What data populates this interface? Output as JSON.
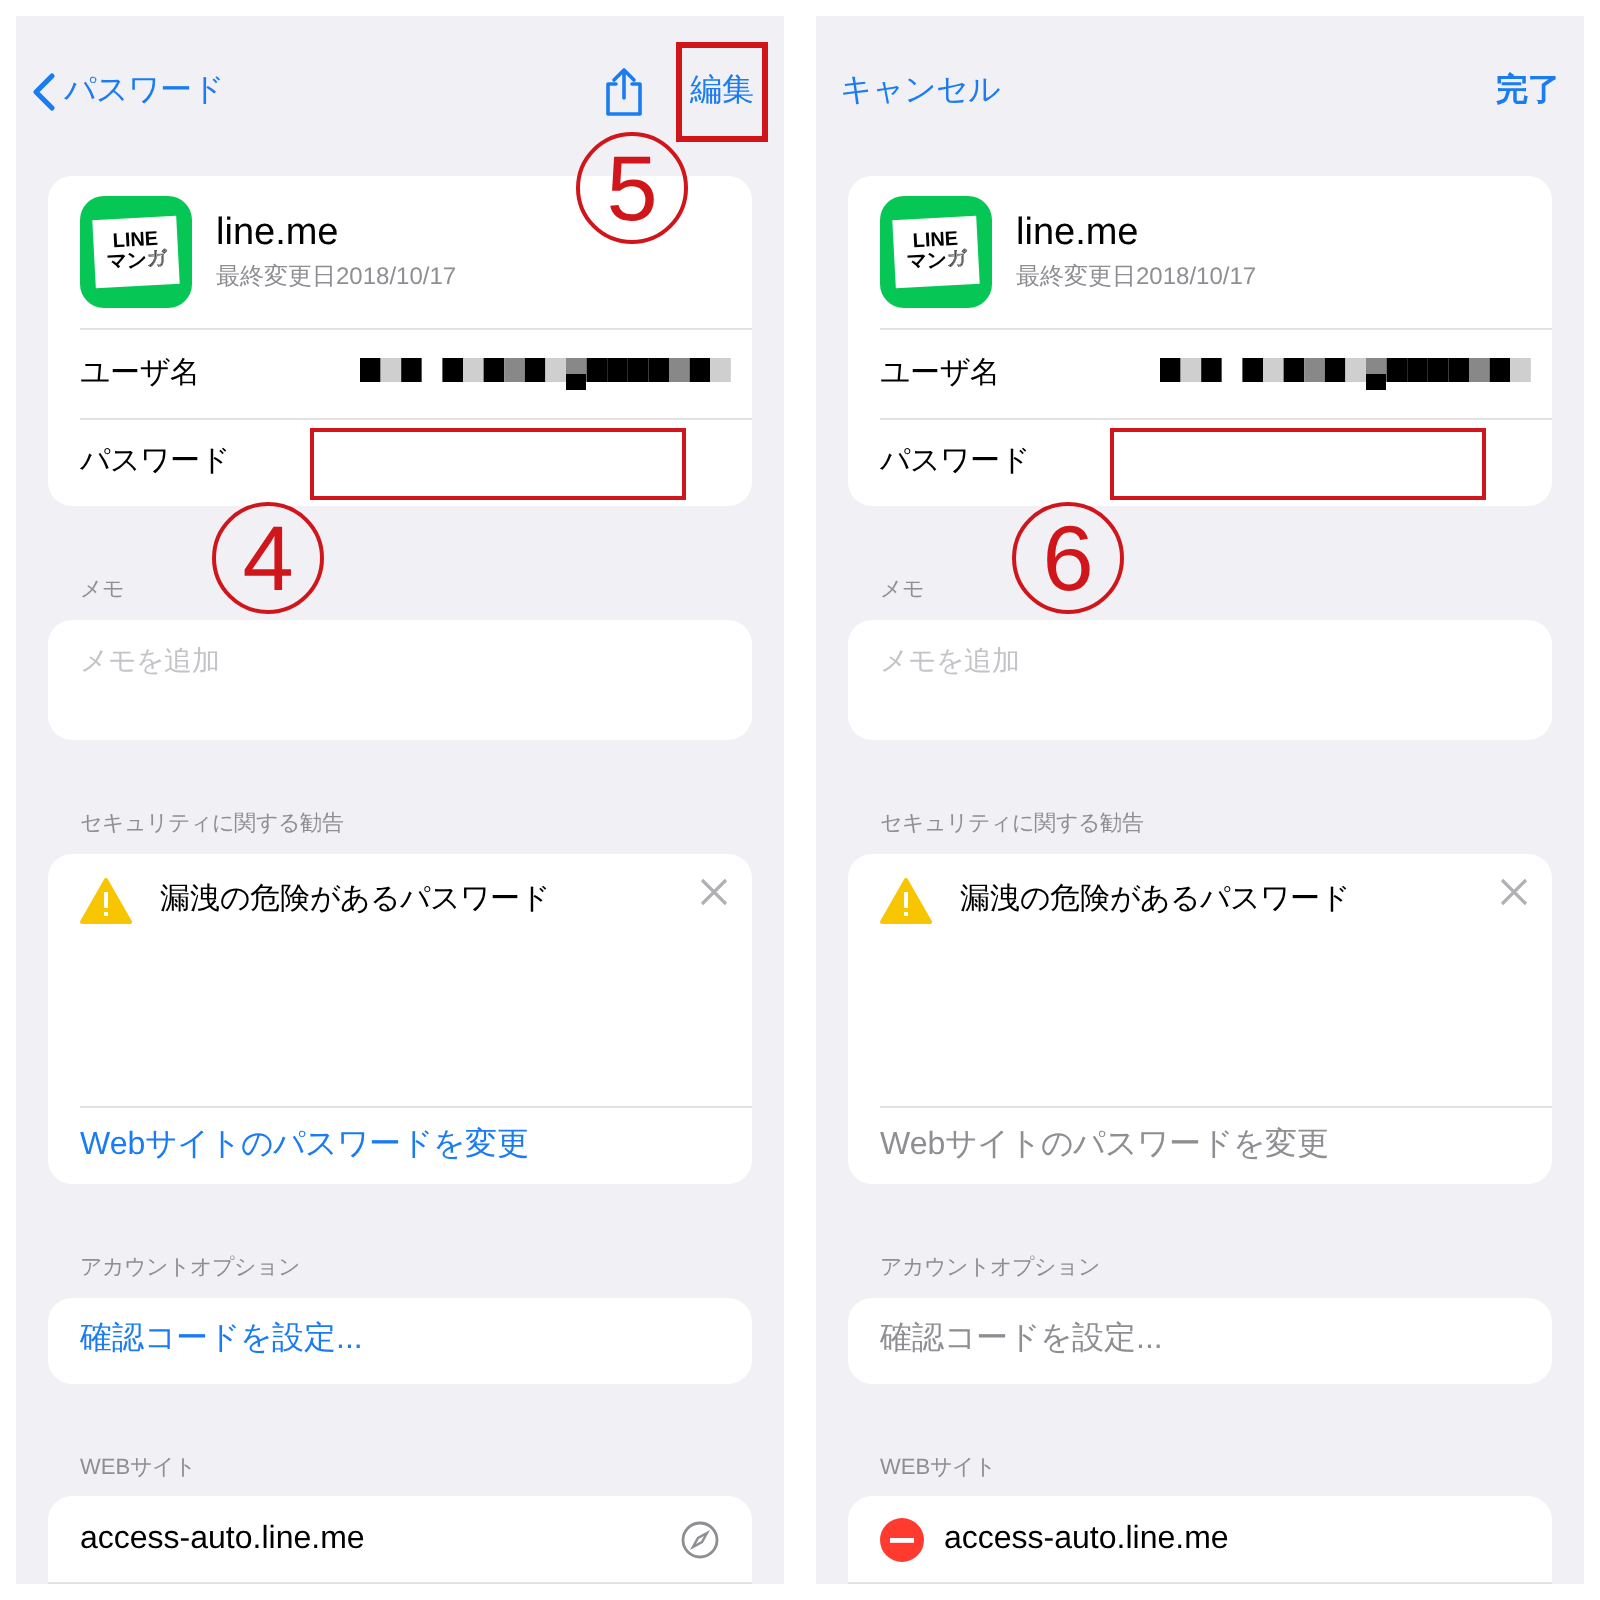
{
  "panels": [
    {
      "nav_left": {
        "text": "パスワード",
        "back": true
      },
      "nav_actions": [
        {
          "kind": "share"
        },
        {
          "kind": "text",
          "text": "編集",
          "bold": false,
          "highlighted": true
        }
      ],
      "site": {
        "logo_lines": [
          "LINE",
          "マンガ"
        ],
        "name": "line.me",
        "modified": "最終変更日2018/10/17"
      },
      "username_label": "ユーザ名",
      "password_label": "パスワード",
      "password_highlighted": true,
      "annotations": [
        {
          "number": "5",
          "kind": "nav"
        },
        {
          "number": "4",
          "kind": "password"
        }
      ],
      "memo": {
        "header": "メモ",
        "placeholder": "メモを追加"
      },
      "security": {
        "header": "セキュリティに関する勧告",
        "warning": "漏洩の危険があるパスワード",
        "action": "Webサイトのパスワードを変更",
        "disabled": false
      },
      "account": {
        "header": "アカウントオプション",
        "action": "確認コードを設定...",
        "disabled": false
      },
      "websites": {
        "header": "WEBサイト",
        "items": [
          {
            "url": "access-auto.line.me",
            "deletable": false
          }
        ]
      }
    },
    {
      "nav_left": {
        "text": "キャンセル",
        "back": false
      },
      "nav_actions": [
        {
          "kind": "text",
          "text": "完了",
          "bold": true,
          "highlighted": false
        }
      ],
      "site": {
        "logo_lines": [
          "LINE",
          "マンガ"
        ],
        "name": "line.me",
        "modified": "最終変更日2018/10/17"
      },
      "username_label": "ユーザ名",
      "password_label": "パスワード",
      "password_highlighted": true,
      "annotations": [
        {
          "number": "6",
          "kind": "password"
        }
      ],
      "memo": {
        "header": "メモ",
        "placeholder": "メモを追加"
      },
      "security": {
        "header": "セキュリティに関する勧告",
        "warning": "漏洩の危険があるパスワード",
        "action": "Webサイトのパスワードを変更",
        "disabled": true
      },
      "account": {
        "header": "アカウントオプション",
        "action": "確認コードを設定...",
        "disabled": true
      },
      "websites": {
        "header": "WEBサイト",
        "items": [
          {
            "url": "access-auto.line.me",
            "deletable": true
          }
        ]
      }
    }
  ]
}
